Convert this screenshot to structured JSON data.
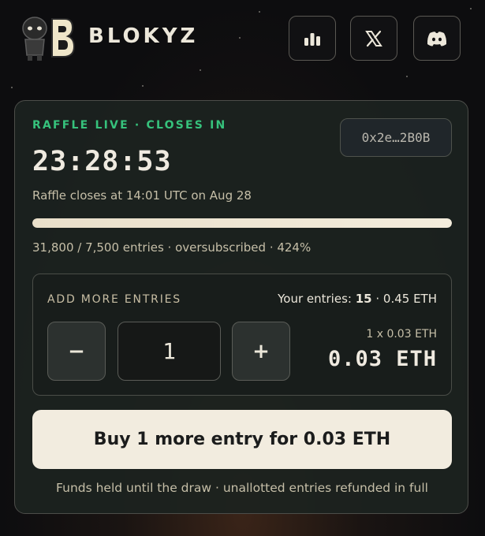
{
  "header": {
    "brand": "BLOKYZ",
    "buttons": [
      {
        "icon": "bar-chart-icon"
      },
      {
        "icon": "x-logo-icon"
      },
      {
        "icon": "discord-icon"
      }
    ]
  },
  "raffle": {
    "status_label": "RAFFLE LIVE · CLOSES IN",
    "address": "0x2e…2B0B",
    "countdown": "23:28:53",
    "closes_text": "Raffle closes at 14:01 UTC on Aug 28",
    "progress_fraction": 1.0,
    "entries_stat": "31,800 / 7,500 entries · oversubscribed · 424%"
  },
  "entry_panel": {
    "title": "ADD MORE ENTRIES",
    "your_entries_label": "Your entries:",
    "your_entries_count": "15",
    "your_entries_total": "· 0.45 ETH",
    "minus_label": "−",
    "quantity": "1",
    "plus_label": "+",
    "unit_price": "1 x 0.03 ETH",
    "total_price": "0.03 ETH"
  },
  "buy_button_label": "Buy 1 more entry for 0.03 ETH",
  "footnote": "Funds held until the draw · unallotted entries refunded in full",
  "colors": {
    "accent_green": "#36c27c",
    "button_cream": "#f2ecdf",
    "card_bg": "#1c221f"
  }
}
